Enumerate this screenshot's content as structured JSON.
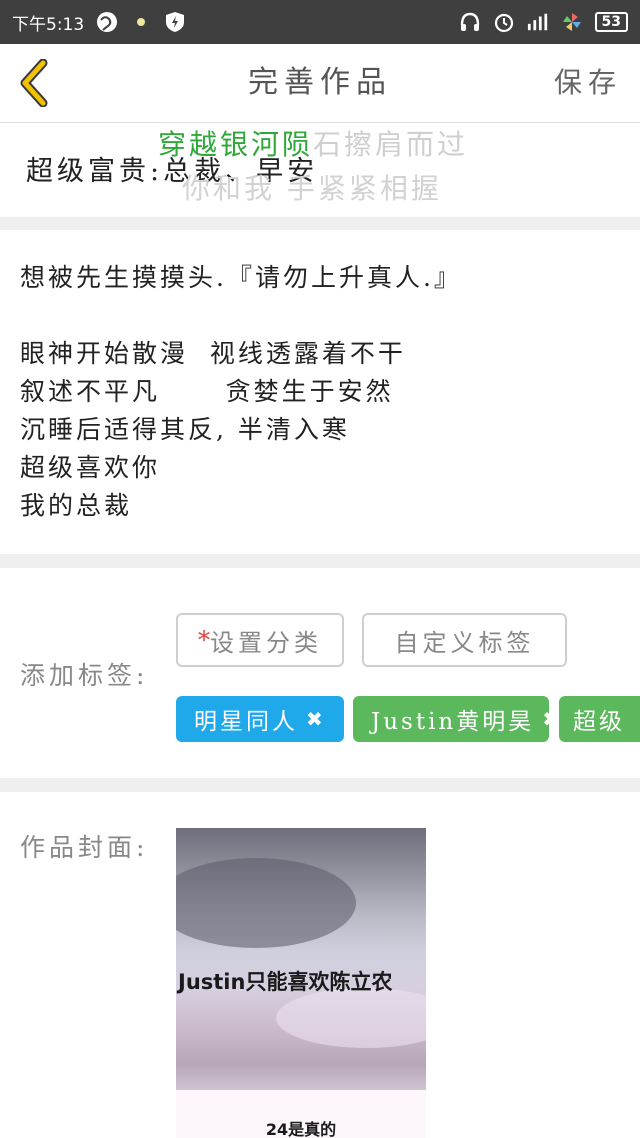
{
  "status_bar": {
    "time": "下午5:13",
    "battery": "53"
  },
  "nav": {
    "title": "完善作品",
    "save_label": "保存"
  },
  "work": {
    "title": "超级富贵:总裁、早安",
    "overlay_line1_green": "穿越银河陨",
    "overlay_line1_grey": "石擦肩而过",
    "overlay_line2": "你和我 手紧紧相握"
  },
  "description": {
    "lines": [
      "想被先生摸摸头.『请勿上升真人.』",
      "",
      "眼神开始散漫  视线透露着不干",
      "叙述不平凡      贪婪生于安然",
      "沉睡后适得其反, 半清入寒",
      "超级喜欢你",
      "我的总裁"
    ]
  },
  "tags": {
    "label": "添加标签:",
    "set_category_label": "设置分类",
    "custom_tag_label": "自定义标签",
    "items": [
      {
        "label": "明星同人",
        "color": "#1fa9ea"
      },
      {
        "label": "Justin黄明昊",
        "color": "#5cb85c"
      },
      {
        "label": "超级",
        "color": "#5cb85c"
      }
    ]
  },
  "cover": {
    "label": "作品封面:",
    "text_main": "Justin只能喜欢陈立农",
    "text_bottom": "24是真的"
  },
  "colors": {
    "accent_yellow": "#f2c200",
    "tag_blue": "#1fa9ea",
    "tag_green": "#5cb85c",
    "overlay_green": "#2fa83a"
  }
}
